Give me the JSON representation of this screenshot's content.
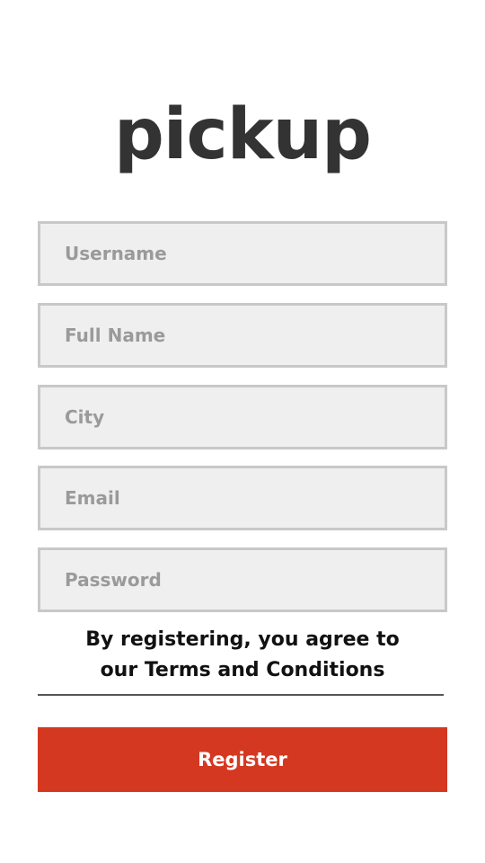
{
  "app": {
    "logo_text": "pickup"
  },
  "form": {
    "username_placeholder": "Username",
    "fullname_placeholder": "Full Name",
    "city_placeholder": "City",
    "email_placeholder": "Email",
    "password_placeholder": "Password"
  },
  "terms": {
    "line1": "By registering, you agree to",
    "line2": "our Terms and Conditions"
  },
  "actions": {
    "register_label": "Register"
  },
  "colors": {
    "accent": "#d43821",
    "logo": "#333333",
    "field_background": "#efefef",
    "field_border": "#c8c8c8"
  }
}
